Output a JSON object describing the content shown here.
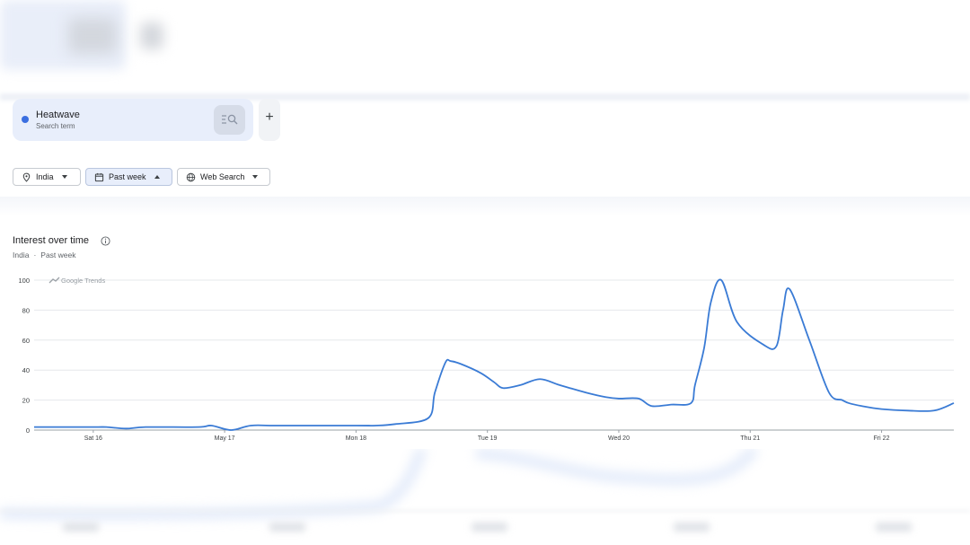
{
  "search_term": {
    "name": "Heatwave",
    "type": "Search term",
    "color": "#3a6ee0",
    "add_label": "+"
  },
  "filters": {
    "region": "India",
    "time": "Past week",
    "property": "Web Search"
  },
  "chart_header": {
    "title": "Interest over time",
    "region": "India",
    "separator": "·",
    "time": "Past week"
  },
  "chart_data": {
    "type": "line",
    "watermark": "Google Trends",
    "x_tick_labels": [
      "Sat 16",
      "May 17",
      "Mon 18",
      "Tue 19",
      "Wed 20",
      "Thu 21",
      "Fri 22"
    ],
    "x_tick_days": [
      1,
      2,
      3,
      4,
      5,
      6,
      7
    ],
    "y_ticks": [
      0,
      20,
      40,
      60,
      80,
      100
    ],
    "ylim": [
      0,
      100
    ],
    "xlim": [
      0.55,
      7.55
    ],
    "grid": true,
    "series": [
      {
        "color": "#3a7bd5",
        "x": [
          0.55,
          1.0,
          1.1,
          1.25,
          1.4,
          1.8,
          1.9,
          2.05,
          2.2,
          2.4,
          3.0,
          3.15,
          3.3,
          3.55,
          3.6,
          3.68,
          3.72,
          3.8,
          3.95,
          4.05,
          4.12,
          4.25,
          4.4,
          4.55,
          4.75,
          4.9,
          5.0,
          5.15,
          5.25,
          5.4,
          5.55,
          5.58,
          5.65,
          5.7,
          5.78,
          5.9,
          6.1,
          6.2,
          6.25,
          6.3,
          6.45,
          6.6,
          6.7,
          6.75,
          6.85,
          7.0,
          7.2,
          7.4,
          7.55
        ],
        "y": [
          2,
          2,
          2,
          1,
          2,
          2,
          3,
          0,
          3,
          3,
          3,
          3,
          4,
          8,
          25,
          45,
          46,
          44,
          38,
          32,
          28,
          30,
          34,
          30,
          25,
          22,
          21,
          21,
          16,
          17,
          18,
          30,
          55,
          85,
          100,
          72,
          57,
          56,
          80,
          94,
          60,
          25,
          20,
          18,
          16,
          14,
          13,
          13,
          18
        ]
      }
    ]
  }
}
